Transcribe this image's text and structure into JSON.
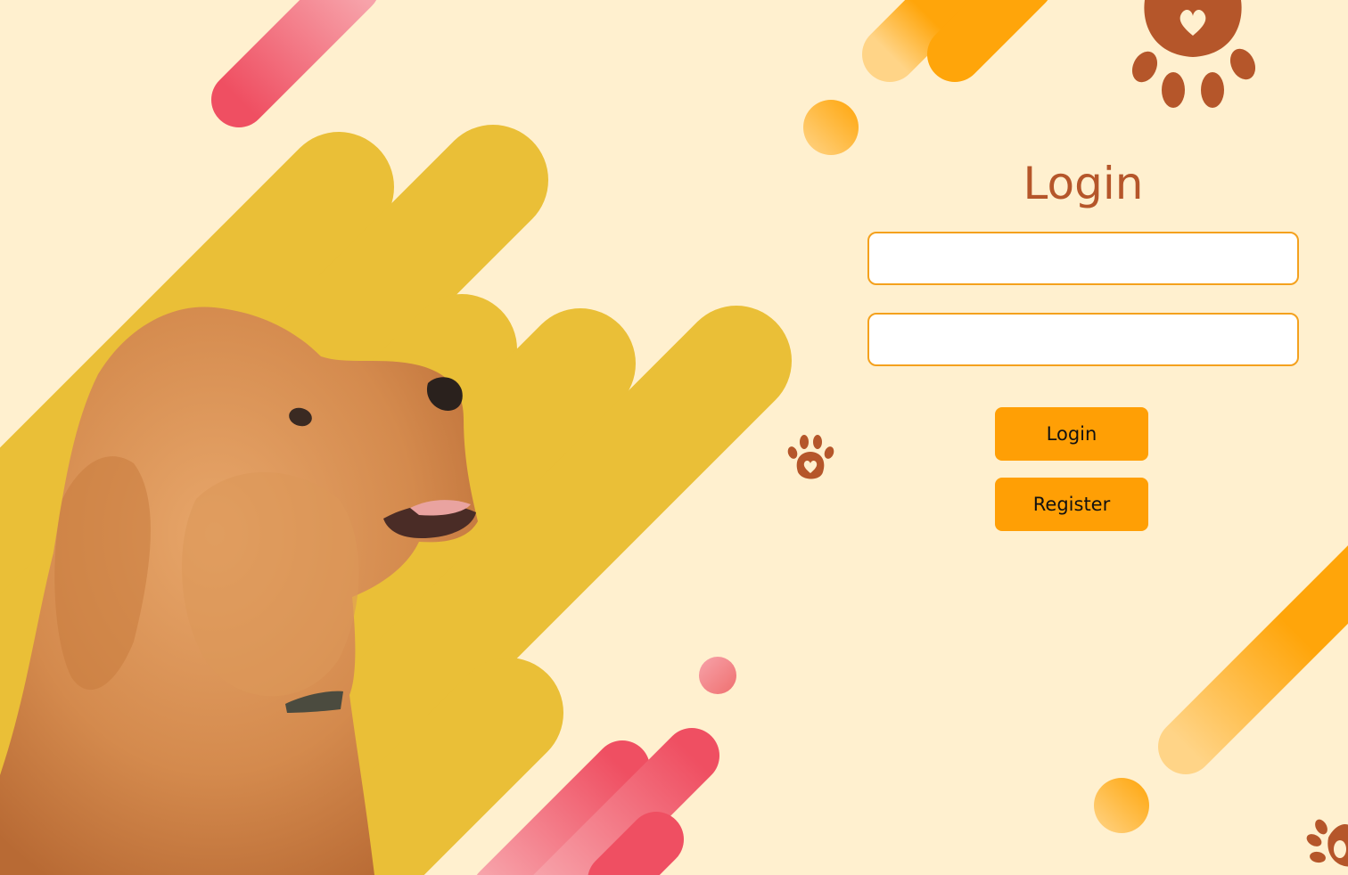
{
  "login": {
    "title": "Login",
    "username_value": "",
    "password_value": "",
    "login_button": "Login",
    "register_button": "Register"
  },
  "colors": {
    "background": "#fff0cf",
    "accent_orange": "#ff9f05",
    "field_border": "#f4a11d",
    "title_brown": "#b5562a",
    "mustard_shape": "#eabf37",
    "pink_stripe": "#ef4f62",
    "paw_brown": "#b5562a"
  },
  "icons": [
    "paw-print-icon"
  ]
}
